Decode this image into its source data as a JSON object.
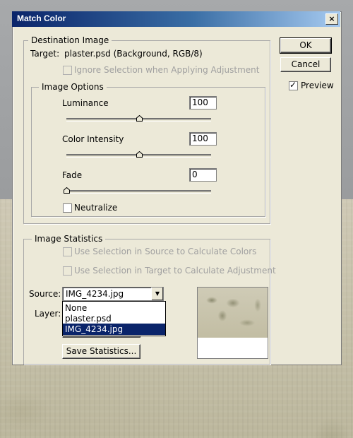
{
  "dialog": {
    "title": "Match Color",
    "close_glyph": "×"
  },
  "buttons": {
    "ok": "OK",
    "cancel": "Cancel",
    "preview_label": "Preview",
    "preview_checked": true
  },
  "destination": {
    "legend": "Destination Image",
    "target_label": "Target:",
    "target_value": "plaster.psd (Background, RGB/8)",
    "ignore_selection": "Ignore Selection when Applying Adjustment"
  },
  "image_options": {
    "legend": "Image Options",
    "luminance_label": "Luminance",
    "luminance_value": "100",
    "luminance_level": 0.5,
    "intensity_label": "Color Intensity",
    "intensity_value": "100",
    "intensity_level": 0.5,
    "fade_label": "Fade",
    "fade_value": "0",
    "fade_level": 0,
    "neutralize": "Neutralize"
  },
  "statistics": {
    "legend": "Image Statistics",
    "use_source": "Use Selection in Source to Calculate Colors",
    "use_target": "Use Selection in Target to Calculate Adjustment",
    "source_label": "Source:",
    "source_value": "IMG_4234.jpg",
    "layer_label": "Layer:",
    "save_stats": "Save Statistics...",
    "source_options": [
      "None",
      "plaster.psd",
      "IMG_4234.jpg"
    ],
    "selected_option": 2
  }
}
